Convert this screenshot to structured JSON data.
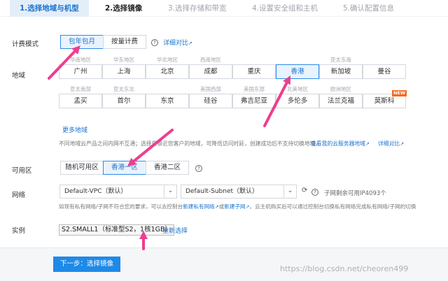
{
  "steps": [
    {
      "label": "1.选择地域与机型",
      "state": "active"
    },
    {
      "label": "2.选择镜像",
      "state": "done"
    },
    {
      "label": "3.选择存储和带宽",
      "state": "todo"
    },
    {
      "label": "4.设置安全组和主机",
      "state": "todo"
    },
    {
      "label": "5.确认配置信息",
      "state": "todo"
    }
  ],
  "billing": {
    "label": "计费模式",
    "options": [
      "包年包月",
      "按量计费"
    ],
    "selected": "包年包月",
    "compare_link": "详细对比"
  },
  "region": {
    "label": "地域",
    "rows": [
      [
        {
          "area": "华南地区",
          "city": "广州"
        },
        {
          "area": "华东地区",
          "city": "上海"
        },
        {
          "area": "华北地区",
          "city": "北京"
        },
        {
          "area": "西南地区",
          "city": "成都"
        },
        {
          "area": "",
          "city": "重庆"
        },
        {
          "area": "",
          "city": "香港",
          "selected": true
        },
        {
          "area": "亚太东南",
          "city": "新加坡"
        },
        {
          "area": "",
          "city": "曼谷"
        }
      ],
      [
        {
          "area": "亚太南部",
          "city": "孟买"
        },
        {
          "area": "亚太东北",
          "city": "首尔"
        },
        {
          "area": "",
          "city": "东京"
        },
        {
          "area": "美国西部",
          "city": "硅谷"
        },
        {
          "area": "美国东部",
          "city": "弗吉尼亚"
        },
        {
          "area": "北美地区",
          "city": "多伦多"
        },
        {
          "area": "欧洲地区",
          "city": "法兰克福"
        },
        {
          "area": "",
          "city": "莫斯科",
          "badge": "NEW"
        }
      ]
    ],
    "more_link": "更多地域",
    "note": "不同地域云产品之间内网不互通；选择最靠近您客户的地域，可降低访问时延，创建成功后不支持切换地域。",
    "my_region_link": "查看我的云服务器地域",
    "compare_link": "详细对比"
  },
  "zone": {
    "label": "可用区",
    "options": [
      "随机可用区",
      "香港一区",
      "香港二区"
    ],
    "selected": "香港一区"
  },
  "network": {
    "label": "网络",
    "vpc": "Default-VPC（默认）",
    "subnet": "Default-Subnet（默认）",
    "remaining": "子网剩余可用IP4093个",
    "hint_prefix": "如现有私有网络/子网不符合您的要求，可以去控制台",
    "link1": "新建私有网络",
    "link_or": "或",
    "link2": "新建子网",
    "hint_suffix": "。云主机购买后可以通过控制台切换私有网络完成私有网络/子网的切换"
  },
  "instance": {
    "label": "实例",
    "value": "S2.SMALL1（标准型S2，1核1GB）",
    "reselect": "重新选择"
  },
  "footer": {
    "next_button": "下一步：选择镜像",
    "watermark": "https://blog.csdn.net/cheoren499"
  },
  "colors": {
    "accent": "#1a73cf",
    "selected_bg": "#e9f3fd",
    "primary_button": "#1e8ae8",
    "arrow": "#ee3d8f",
    "badge": "#f26b21"
  },
  "icons": {
    "help": "question-circle-icon",
    "external_link": "external-link-icon",
    "dropdown": "chevron-down-icon",
    "refresh": "refresh-icon",
    "annotation": "annotation-arrow"
  }
}
